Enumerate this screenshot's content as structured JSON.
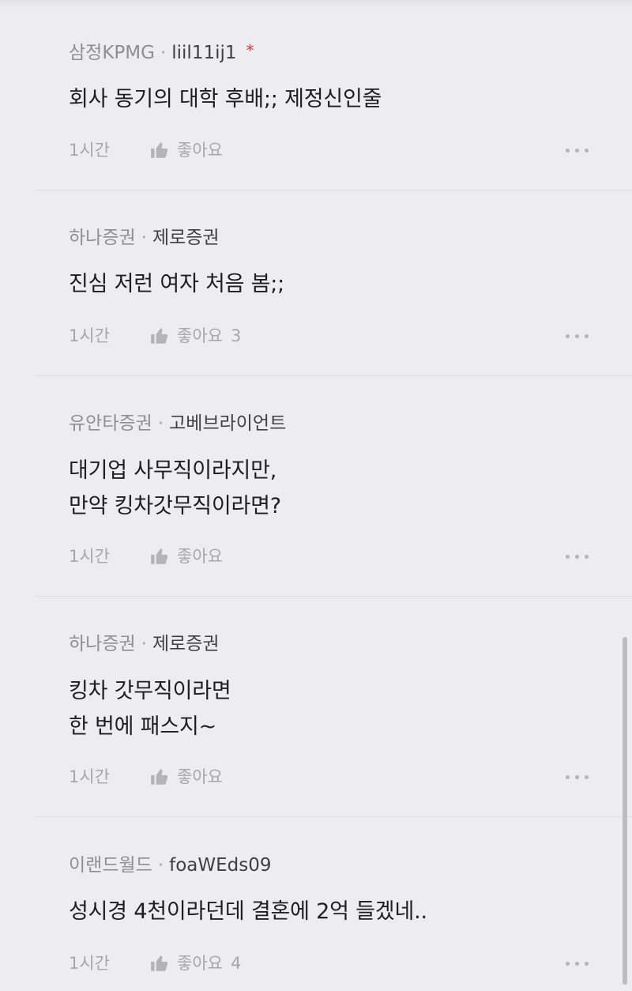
{
  "comments": [
    {
      "company": "삼정KPMG",
      "nickname": "liil11ij1",
      "author_mark": "*",
      "lines": [
        "회사 동기의 대학 후배;; 제정신인줄"
      ],
      "time": "1시간",
      "like_label": "좋아요",
      "like_count": ""
    },
    {
      "company": "하나증권",
      "nickname": "제로증권",
      "lines": [
        "진심 저런 여자 처음 봄;;"
      ],
      "time": "1시간",
      "like_label": "좋아요",
      "like_count": "3"
    },
    {
      "company": "유안타증권",
      "nickname": "고베브라이언트",
      "lines": [
        "대기업 사무직이라지만,",
        "만약 킹차갓무직이라면?"
      ],
      "time": "1시간",
      "like_label": "좋아요",
      "like_count": ""
    },
    {
      "company": "하나증권",
      "nickname": "제로증권",
      "lines": [
        "킹차 갓무직이라면",
        "한 번에 패스지~"
      ],
      "time": "1시간",
      "like_label": "좋아요",
      "like_count": ""
    },
    {
      "company": "이랜드월드",
      "nickname": "foaWEds09",
      "lines": [
        "성시경 4천이라던데 결혼에 2억 들겠네.."
      ],
      "time": "1시간",
      "like_label": "좋아요",
      "like_count": "4"
    }
  ],
  "separator": "·",
  "icons": {
    "like": "thumbs-up-icon",
    "more": "more-dots-icon"
  },
  "colors": {
    "background": "#ededf0",
    "mark": "#e0343a",
    "meta": "#a6a6ab"
  }
}
